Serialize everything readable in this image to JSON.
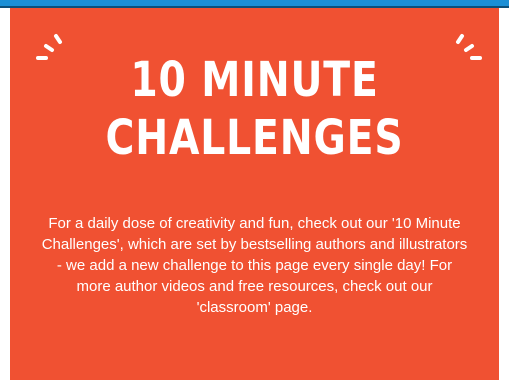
{
  "banner": {
    "title_line_1": "10 MINUTE",
    "title_line_2": "CHALLENGES",
    "description": "For a daily dose of creativity and fun, check out our '10 Minute Challenges', which are set by bestselling authors and illustrators - we add a new challenge to this page every single day! For more author videos and free resources, check out our 'classroom' page."
  },
  "colors": {
    "panel_background": "#f05132",
    "text": "#ffffff",
    "top_bar": "#1b8fd6"
  },
  "icons": {
    "left_decoration": "sparkle-lines-icon",
    "right_decoration": "sparkle-lines-icon"
  }
}
